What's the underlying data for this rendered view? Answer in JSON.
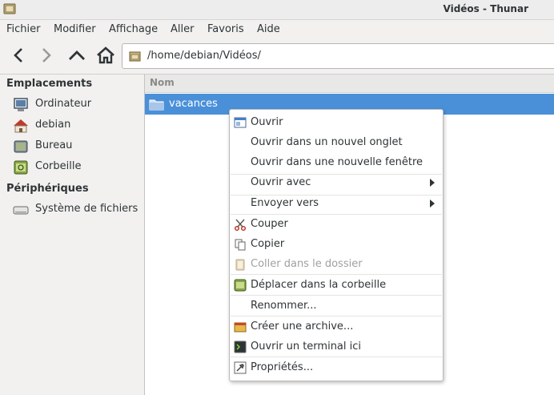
{
  "window": {
    "title": "Vidéos - Thunar"
  },
  "menubar": {
    "items": [
      "Fichier",
      "Modifier",
      "Affichage",
      "Aller",
      "Favoris",
      "Aide"
    ]
  },
  "toolbar": {
    "path": "/home/debian/Vidéos/"
  },
  "sidebar": {
    "places_header": "Emplacements",
    "places": [
      {
        "label": "Ordinateur",
        "icon": "computer-icon"
      },
      {
        "label": "debian",
        "icon": "home-icon"
      },
      {
        "label": "Bureau",
        "icon": "desktop-icon"
      },
      {
        "label": "Corbeille",
        "icon": "trash-icon"
      }
    ],
    "devices_header": "Périphériques",
    "devices": [
      {
        "label": "Système de fichiers",
        "icon": "drive-icon"
      }
    ]
  },
  "main": {
    "column_header": "Nom",
    "rows": [
      {
        "name": "vacances",
        "selected": true,
        "icon": "folder-icon"
      }
    ]
  },
  "context_menu": {
    "items": [
      {
        "label": "Ouvrir"
      },
      {
        "label": "Ouvrir dans un nouvel onglet"
      },
      {
        "label": "Ouvrir dans une nouvelle fenêtre"
      },
      {
        "label": "Ouvrir avec"
      },
      {
        "label": "Envoyer vers"
      },
      {
        "label": "Couper"
      },
      {
        "label": "Copier"
      },
      {
        "label": "Coller dans le dossier",
        "disabled": true
      },
      {
        "label": "Déplacer dans la corbeille"
      },
      {
        "label": "Renommer..."
      },
      {
        "label": "Créer une archive..."
      },
      {
        "label": "Ouvrir un terminal ici"
      },
      {
        "label": "Propriétés..."
      }
    ]
  },
  "colors": {
    "selection": "#4a90d9",
    "window_bg": "#f2f1f0"
  }
}
